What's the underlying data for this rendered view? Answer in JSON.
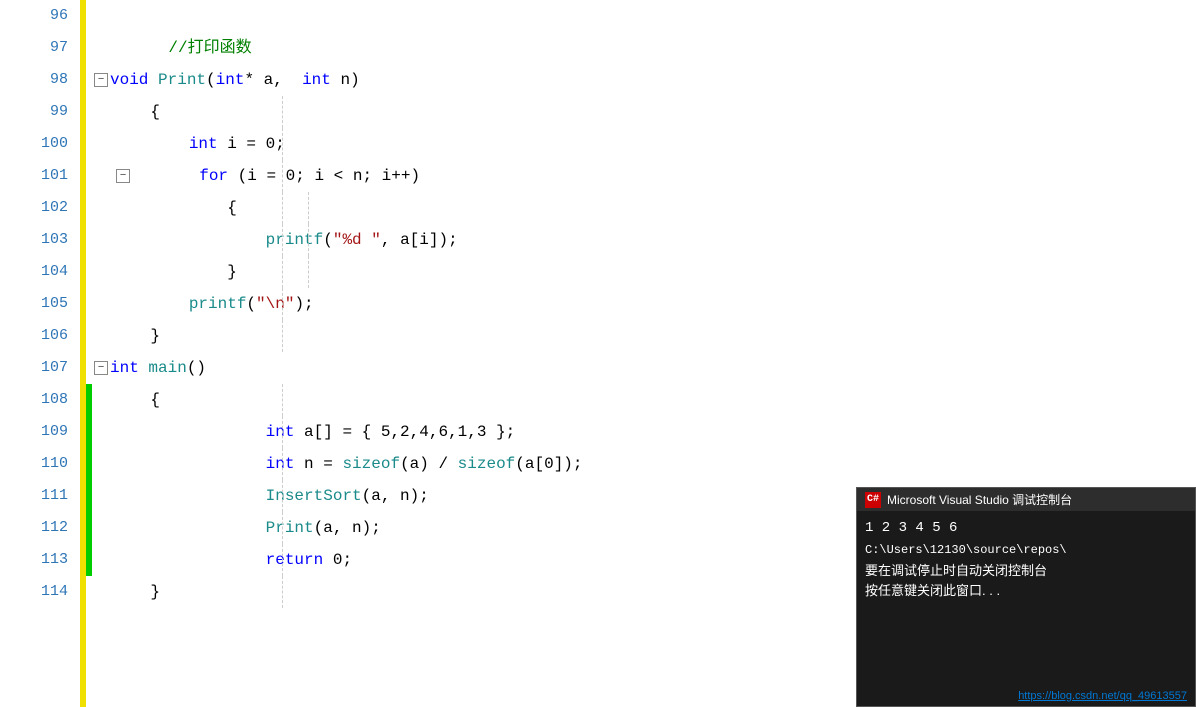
{
  "lines": [
    {
      "num": "96",
      "content": "",
      "type": "empty"
    },
    {
      "num": "97",
      "content": "    //打印函数",
      "type": "comment"
    },
    {
      "num": "98",
      "content": "void Print(int* a,  int n)",
      "type": "code98",
      "collapse": true
    },
    {
      "num": "99",
      "content": "    {",
      "type": "brace"
    },
    {
      "num": "100",
      "content": "        int i = 0;",
      "type": "code100"
    },
    {
      "num": "101",
      "content": "        for (i = 0; i < n; i++)",
      "type": "code101",
      "collapse": true
    },
    {
      "num": "102",
      "content": "        {",
      "type": "brace2"
    },
    {
      "num": "103",
      "content": "            printf(\"%d \", a[i]);",
      "type": "code103"
    },
    {
      "num": "104",
      "content": "        }",
      "type": "brace2close"
    },
    {
      "num": "105",
      "content": "        printf(\"\\n\");",
      "type": "code105"
    },
    {
      "num": "106",
      "content": "    }",
      "type": "braceclose"
    },
    {
      "num": "107",
      "content": "int main()",
      "type": "code107",
      "collapse": true
    },
    {
      "num": "108",
      "content": "    {",
      "type": "brace_green"
    },
    {
      "num": "109",
      "content": "            int a[] = { 5,2,4,6,1,3 };",
      "type": "code109"
    },
    {
      "num": "110",
      "content": "            int n = sizeof(a) / sizeof(a[0]);",
      "type": "code110"
    },
    {
      "num": "111",
      "content": "            InsertSort(a, n);",
      "type": "code111"
    },
    {
      "num": "112",
      "content": "            Print(a, n);",
      "type": "code112"
    },
    {
      "num": "113",
      "content": "            return 0;",
      "type": "code113"
    },
    {
      "num": "114",
      "content": "    }",
      "type": "braceclose2"
    }
  ],
  "terminal": {
    "title": "Microsoft Visual Studio 调试控制台",
    "icon_label": "C#",
    "output_line1": "1  2  3  4  5  6",
    "output_line2": "C:\\Users\\12130\\source\\repos\\",
    "output_line3_zh": "要在调试停止时自动关闭控制台",
    "output_line4_zh": "按任意键关闭此窗口. . .",
    "footer_url": "https://blog.csdn.net/qq_49613557"
  }
}
